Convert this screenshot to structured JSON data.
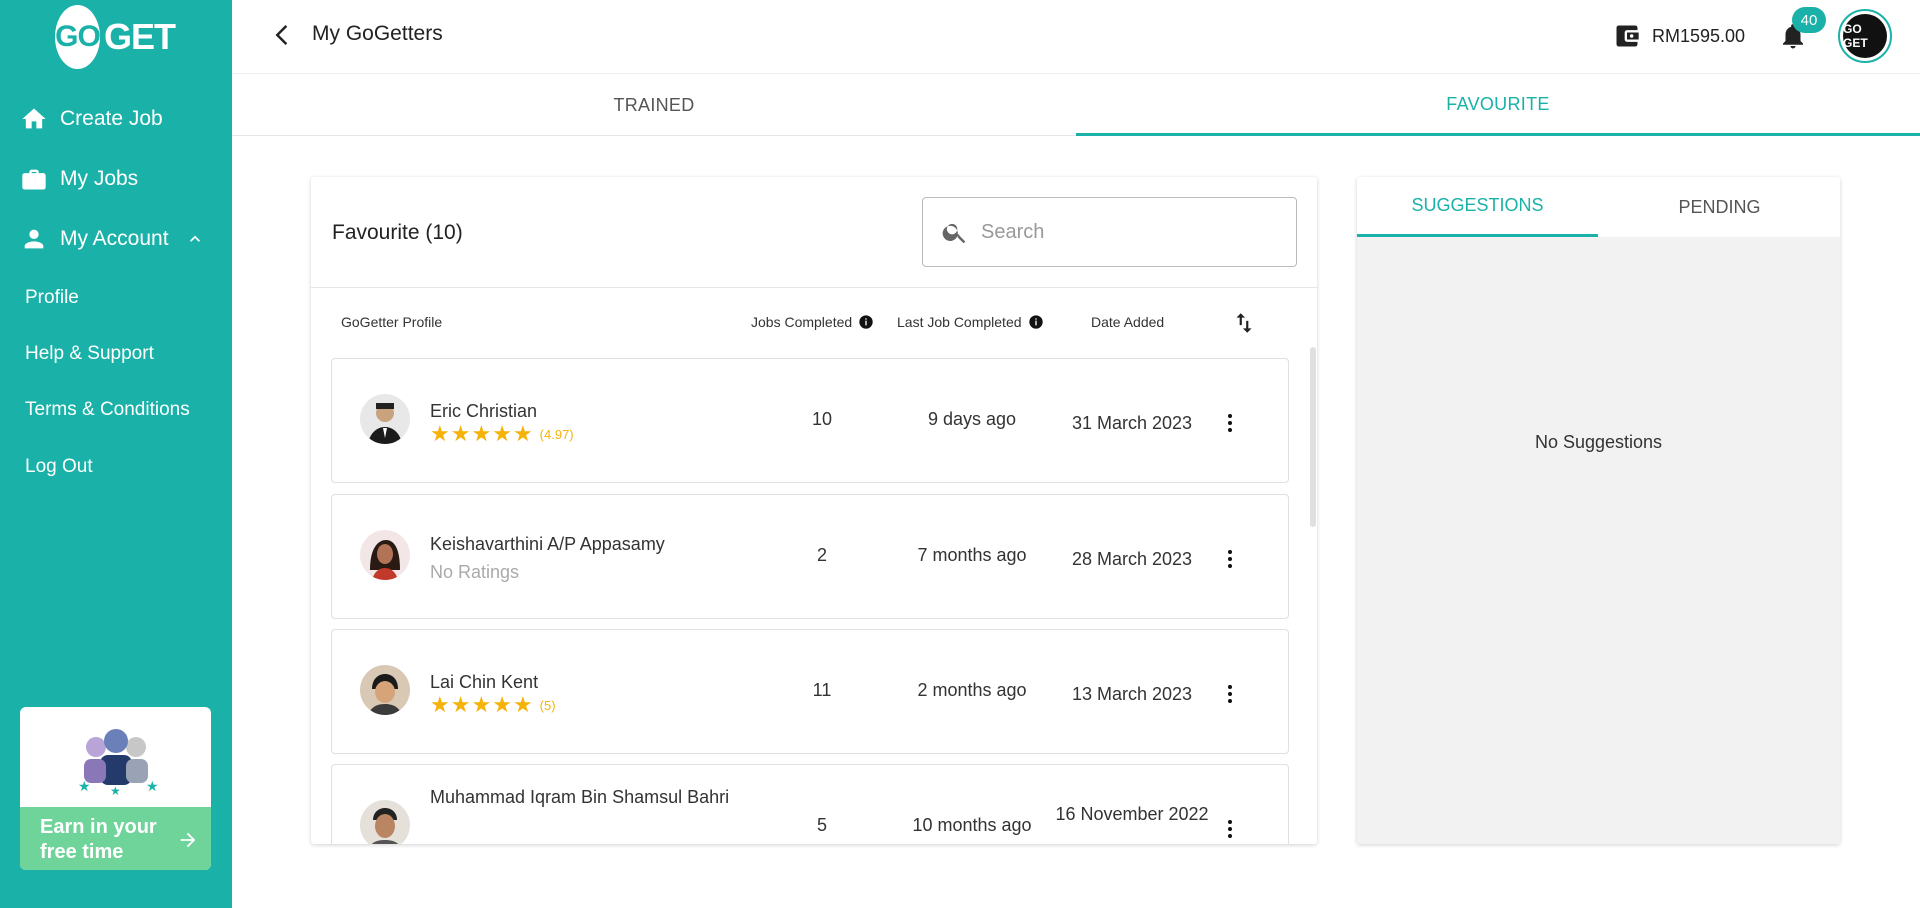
{
  "brand": {
    "logo_go": "GO",
    "logo_get": "GET"
  },
  "sidebar": {
    "nav": [
      {
        "label": "Create Job",
        "icon": "home-icon"
      },
      {
        "label": "My Jobs",
        "icon": "briefcase-icon"
      },
      {
        "label": "My Account",
        "icon": "person-icon"
      }
    ],
    "account_items": [
      {
        "label": "Profile"
      },
      {
        "label": "Help & Support"
      },
      {
        "label": "Terms & Conditions"
      },
      {
        "label": "Log Out"
      }
    ],
    "promo": {
      "text_line1": "Earn in your",
      "text_line2": "free time"
    }
  },
  "header": {
    "title": "My GoGetters",
    "wallet_amount": "RM1595.00",
    "notification_count": "40",
    "avatar_text": "GO GET"
  },
  "tabs": [
    {
      "label": "TRAINED",
      "active": false
    },
    {
      "label": "FAVOURITE",
      "active": true
    }
  ],
  "favourite": {
    "title": "Favourite (10)",
    "search_placeholder": "Search",
    "columns": {
      "profile": "GoGetter Profile",
      "jobs": "Jobs Completed",
      "last_job": "Last Job Completed",
      "date_added": "Date Added"
    },
    "rows": [
      {
        "name": "Eric Christian",
        "stars": 5,
        "score": "(4.97)",
        "no_rating": "",
        "jobs": "10",
        "last_job": "9 days ago",
        "date_added": "31 March 2023"
      },
      {
        "name": "Keishavarthini A/P Appasamy",
        "stars": 0,
        "score": "",
        "no_rating": "No Ratings",
        "jobs": "2",
        "last_job": "7 months ago",
        "date_added": "28 March 2023"
      },
      {
        "name": "Lai Chin Kent",
        "stars": 5,
        "score": "(5)",
        "no_rating": "",
        "jobs": "11",
        "last_job": "2 months ago",
        "date_added": "13 March 2023"
      },
      {
        "name": "Muhammad Iqram Bin Shamsul Bahri",
        "stars": 0,
        "score": "",
        "no_rating": "",
        "jobs": "5",
        "last_job": "10 months ago",
        "date_added": "16 November 2022"
      }
    ]
  },
  "side_panel": {
    "tabs": [
      {
        "label": "SUGGESTIONS",
        "active": true
      },
      {
        "label": "PENDING",
        "active": false
      }
    ],
    "empty_text": "No Suggestions"
  },
  "colors": {
    "brand": "#1ab2a8",
    "star": "#f5b30a",
    "promo": "#6fd49a"
  }
}
